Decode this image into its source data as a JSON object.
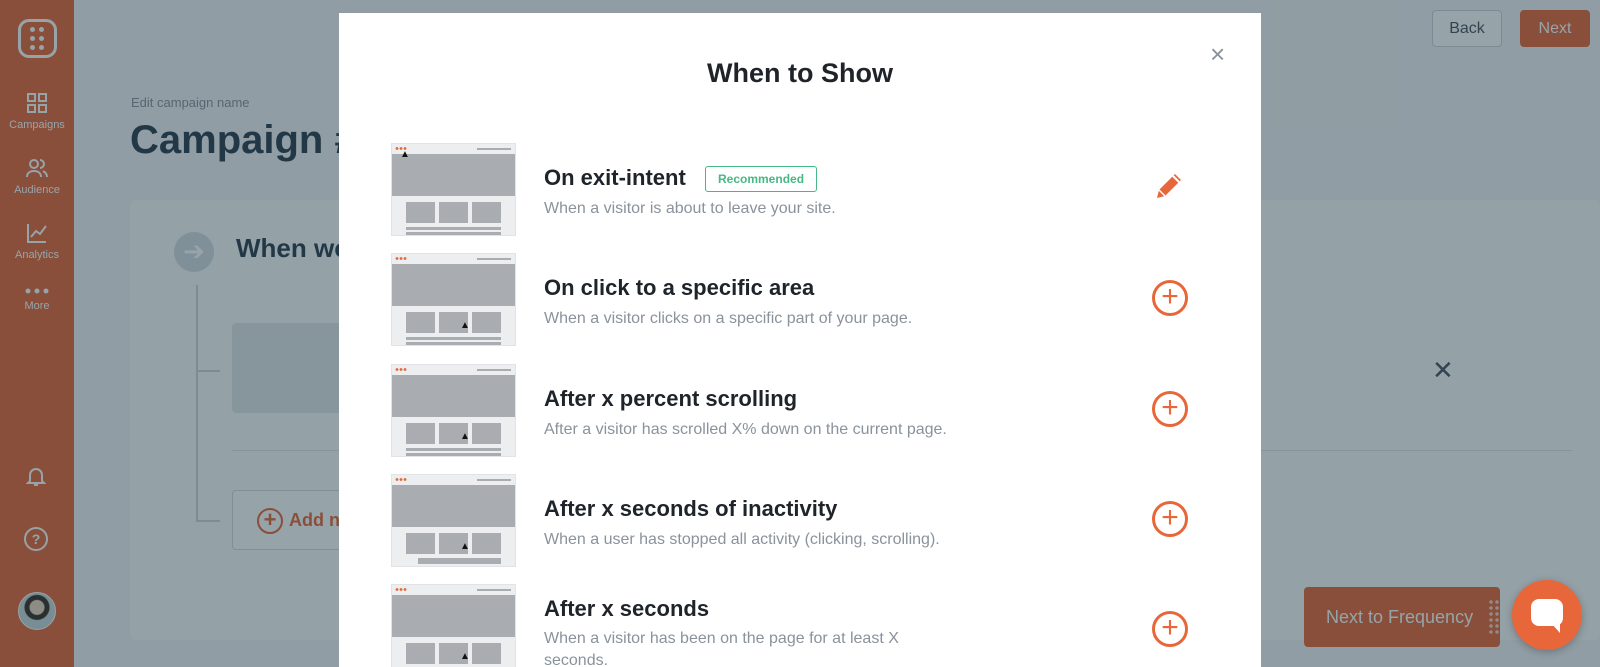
{
  "sidebar": {
    "items": [
      {
        "label": "Campaigns",
        "icon": "grid-icon"
      },
      {
        "label": "Audience",
        "icon": "users-icon"
      },
      {
        "label": "Analytics",
        "icon": "chart-icon"
      },
      {
        "label": "More",
        "icon": "more-icon"
      }
    ],
    "help_glyph": "?"
  },
  "header": {
    "back_label": "Back",
    "next_label": "Next"
  },
  "page": {
    "edit_label": "Edit campaign name",
    "title": "Campaign #",
    "step_title": "When wo",
    "add_label": "Add n",
    "next_frequency_label": "Next to Frequency"
  },
  "modal": {
    "title": "When to Show",
    "close_glyph": "×",
    "options": [
      {
        "title": "On exit-intent",
        "badge": "Recommended",
        "description": "When a visitor is about to leave your site.",
        "action": "edit"
      },
      {
        "title": "On click to a specific area",
        "description": "When a visitor clicks on a specific part of your page.",
        "action": "add"
      },
      {
        "title": "After x percent scrolling",
        "description": "After a visitor has scrolled X% down on the current page.",
        "action": "add"
      },
      {
        "title": "After x seconds of inactivity",
        "description": "When a user has stopped all activity (clicking, scrolling).",
        "action": "add"
      },
      {
        "title": "After x seconds",
        "description": "When a visitor has been on the page for at least X seconds.",
        "action": "add"
      }
    ],
    "add_glyph": "+"
  },
  "colors": {
    "accent": "#e8673a",
    "recommended": "#46b885",
    "overlay": "rgba(23,52,62,0.45)"
  }
}
